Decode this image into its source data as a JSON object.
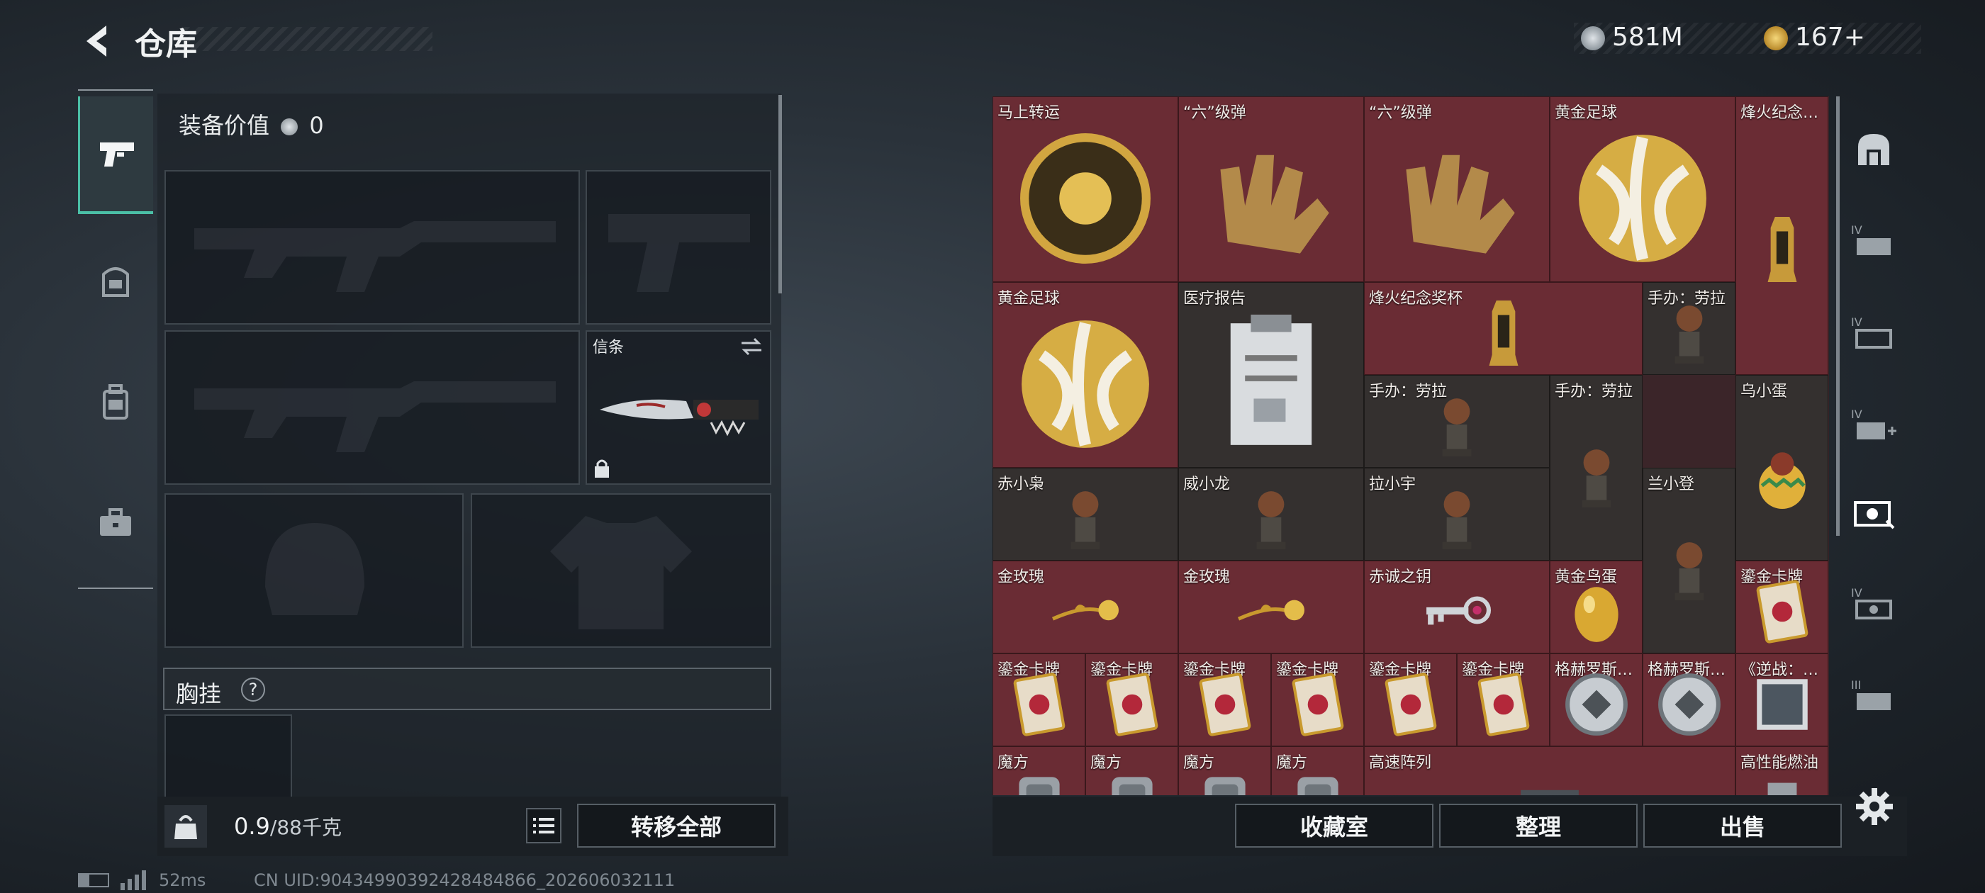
{
  "header": {
    "title": "仓库",
    "back_icon": "back-arrow-icon",
    "currency_silver": "581M",
    "currency_gold": "167+",
    "silver_color": "#b9c0c6",
    "gold_color": "#d9b14a"
  },
  "left_rail": {
    "items": [
      {
        "icon": "pistol-icon",
        "active": true
      },
      {
        "icon": "helmet-vest-icon",
        "active": false
      },
      {
        "icon": "backpack-icon",
        "active": false
      },
      {
        "icon": "toolbox-icon",
        "active": false
      }
    ],
    "accent": "#4bbfa6"
  },
  "equipment": {
    "value_label": "装备价值",
    "value_amount": "0",
    "knife_slot_label": "信条",
    "chest_rig_label": "胸挂",
    "help_symbol": "?"
  },
  "bottom_bar": {
    "weight_current": "0.9",
    "weight_max": "/88千克",
    "transfer_all": "转移全部"
  },
  "stash_items": [
    {
      "name": "马上转运",
      "rarity": "red"
    },
    {
      "name": "“六”级弹",
      "rarity": "red"
    },
    {
      "name": "“六”级弹",
      "rarity": "red"
    },
    {
      "name": "黄金足球",
      "rarity": "red"
    },
    {
      "name": "烽火纪念…",
      "rarity": "red"
    },
    {
      "name": "黄金足球",
      "rarity": "red"
    },
    {
      "name": "医疗报告",
      "rarity": "dark"
    },
    {
      "name": "烽火纪念奖杯",
      "rarity": "red"
    },
    {
      "name": "手办：劳拉",
      "rarity": "dark"
    },
    {
      "name": "手办：劳拉",
      "rarity": "dark"
    },
    {
      "name": "手办：劳拉",
      "rarity": "dark"
    },
    {
      "name": "乌小蛋",
      "rarity": "dark"
    },
    {
      "name": "赤小枭",
      "rarity": "dark"
    },
    {
      "name": "威小龙",
      "rarity": "dark"
    },
    {
      "name": "拉小宇",
      "rarity": "dark"
    },
    {
      "name": "兰小登",
      "rarity": "dark"
    },
    {
      "name": "金玫瑰",
      "rarity": "red"
    },
    {
      "name": "金玫瑰",
      "rarity": "red"
    },
    {
      "name": "赤诚之钥",
      "rarity": "red"
    },
    {
      "name": "黄金鸟蛋",
      "rarity": "red"
    },
    {
      "name": "鎏金卡牌",
      "rarity": "red"
    },
    {
      "name": "鎏金卡牌",
      "rarity": "red"
    },
    {
      "name": "鎏金卡牌",
      "rarity": "red"
    },
    {
      "name": "鎏金卡牌",
      "rarity": "red"
    },
    {
      "name": "鎏金卡牌",
      "rarity": "red"
    },
    {
      "name": "鎏金卡牌",
      "rarity": "red"
    },
    {
      "name": "鎏金卡牌",
      "rarity": "red"
    },
    {
      "name": "格赫罗斯…",
      "rarity": "red"
    },
    {
      "name": "格赫罗斯…",
      "rarity": "red"
    },
    {
      "name": "《逆战：…",
      "rarity": "red"
    },
    {
      "name": "魔方",
      "rarity": "red"
    },
    {
      "name": "魔方",
      "rarity": "red"
    },
    {
      "name": "魔方",
      "rarity": "red"
    },
    {
      "name": "魔方",
      "rarity": "red"
    },
    {
      "name": "高速阵列",
      "rarity": "red"
    },
    {
      "name": "高性能燃油",
      "rarity": "red"
    }
  ],
  "stash_actions": {
    "collection": "收藏室",
    "sort": "整理",
    "sell": "出售"
  },
  "side_rail": {
    "items": [
      "vault-icon",
      "iv-stash-1-icon",
      "iv-stash-2-icon",
      "iv-stash-add-icon",
      "stash-active-icon",
      "iv-stash-3-icon",
      "iii-stash-icon"
    ],
    "settings_icon": "gear-icon"
  },
  "status_bar": {
    "ping": "52ms",
    "uid": "CN UID:90434990392428484866_202606032111"
  }
}
